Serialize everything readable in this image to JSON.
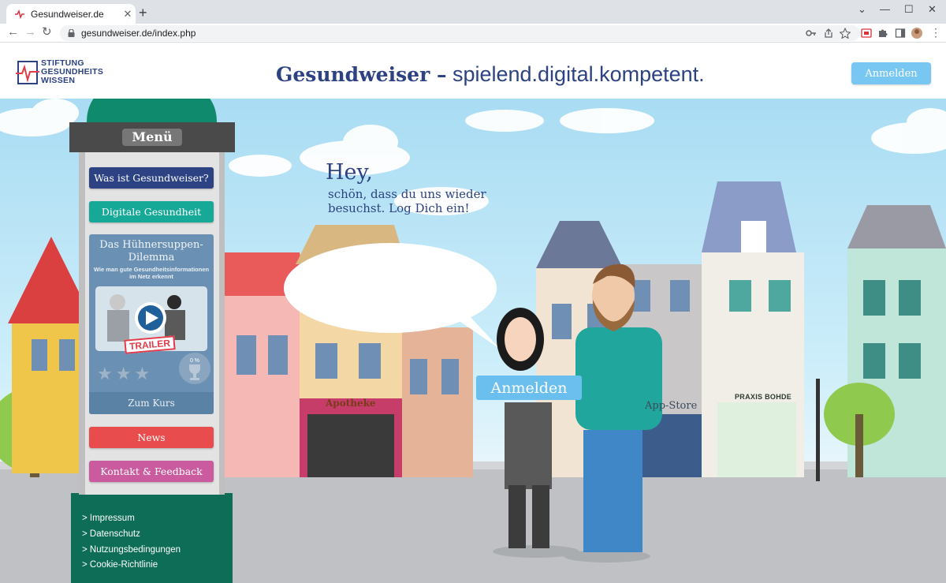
{
  "browser": {
    "tab_title": "Gesundweiser.de",
    "tab_close": "✕",
    "new_tab": "+",
    "url": "gesundweiser.de/index.php",
    "window_controls": [
      "⌄",
      "—",
      "☐",
      "✕"
    ]
  },
  "header": {
    "logo_lines": [
      "STIFTUNG",
      "GESUNDHEITS",
      "WISSEN"
    ],
    "title_bold": "Gesundweiser –",
    "title_rest": " spielend.digital.kompetent.",
    "login_button": "Anmelden"
  },
  "menu": {
    "title": "Menü",
    "items": [
      {
        "label": "Was ist Gesundweiser?",
        "color": "#2c4282"
      },
      {
        "label": "Digitale Gesundheit",
        "color": "#17a997"
      },
      {
        "label": "News",
        "color": "#e84c4c"
      },
      {
        "label": "Kontakt & Feedback",
        "color": "#c95b9e"
      }
    ],
    "course": {
      "title": "Das Hühnersuppen-Dilemma",
      "subtitle": "Wie man gute Gesundheitsinformationen im Netz erkennt",
      "badge": "TRAILER",
      "stars": "★★★",
      "progress": "0 %",
      "button": "Zum Kurs"
    },
    "footer_links": [
      "> Impressum",
      "> Datenschutz",
      "> Nutzungsbedingungen",
      "> Cookie-Richtlinie"
    ]
  },
  "scene": {
    "greeting_title": "Hey,",
    "greeting_text": "schön, dass du uns wieder besuchst. Log Dich ein!",
    "login_button": "Anmelden",
    "shop_signs": {
      "apotheke": "Apotheke",
      "appstore": "App-Store",
      "praxis": "PRAXIS BOHDE"
    }
  },
  "colors": {
    "brand": "#2c4282",
    "accent_blue": "#77c7f2",
    "pillar": "#0e7a63"
  }
}
